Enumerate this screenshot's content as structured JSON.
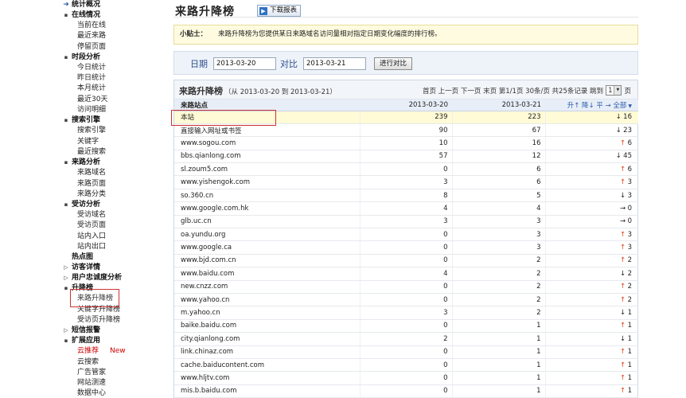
{
  "sidebar": {
    "groups": [
      {
        "label": "统计概况",
        "icon": "circle-arrow",
        "items": []
      },
      {
        "label": "在线情况",
        "icon": "minus",
        "items": [
          "当前在线",
          "最近来路",
          "停留页面"
        ]
      },
      {
        "label": "时段分析",
        "icon": "minus",
        "items": [
          "今日统计",
          "昨日统计",
          "本月统计",
          "最近30天",
          "访问明细"
        ]
      },
      {
        "label": "搜索引擎",
        "icon": "minus",
        "items": [
          "搜索引擎",
          "关键字",
          "最近搜索"
        ]
      },
      {
        "label": "来路分析",
        "icon": "minus",
        "items": [
          "来路域名",
          "来路页面",
          "来路分类"
        ]
      },
      {
        "label": "受访分析",
        "icon": "minus",
        "items": [
          "受访域名",
          "受访页面",
          "站内入口",
          "站内出口"
        ]
      },
      {
        "label": "热点图",
        "icon": "none",
        "items": []
      },
      {
        "label": "访客详情",
        "icon": "expand",
        "items": []
      },
      {
        "label": "用户忠诚度分析",
        "icon": "expand",
        "items": []
      },
      {
        "label": "升降榜",
        "icon": "minus",
        "items": [
          "来路升降榜",
          "关键字升降榜",
          "受访页升降榜"
        ]
      },
      {
        "label": "短信报警",
        "icon": "expand",
        "items": []
      },
      {
        "label": "扩展应用",
        "icon": "minus",
        "items": [
          "云推荐",
          "云搜索",
          "广告管家",
          "网站测速",
          "数据中心"
        ]
      }
    ],
    "new_badge": "New",
    "active_item": "来路升降榜"
  },
  "header": {
    "title": "来路升降榜",
    "download_label": "下载报表"
  },
  "tips": {
    "label": "小贴士：",
    "text": "来路升降榜为您提供某日来路域名访问量相对指定日期变化幅度的排行榜。"
  },
  "filter": {
    "date_label": "日期",
    "date_value": "2013-03-20",
    "compare_label": "对比",
    "compare_value": "2013-03-21",
    "button_label": "进行对比"
  },
  "panel": {
    "title": "来路升降榜",
    "range": "（从 2013-03-20 到 2013-03-21）",
    "pager_text": "首页 上一页 下一页 末页 第1/1页 30条/页 共25条记录 跳到",
    "page_select": "1",
    "page_suffix": "页"
  },
  "table": {
    "headers": [
      "来路站点",
      "2013-03-20",
      "2013-03-21",
      "升↑ 降↓ 平 → 全部"
    ],
    "rows": [
      {
        "site": "本站",
        "d1": "239",
        "d2": "223",
        "dir": "down",
        "chg": "16"
      },
      {
        "site": "直接输入网址或书签",
        "d1": "90",
        "d2": "67",
        "dir": "down",
        "chg": "23"
      },
      {
        "site": "www.sogou.com",
        "d1": "10",
        "d2": "16",
        "dir": "up",
        "chg": "6"
      },
      {
        "site": "bbs.qianlong.com",
        "d1": "57",
        "d2": "12",
        "dir": "down",
        "chg": "45"
      },
      {
        "site": "sl.zoum5.com",
        "d1": "0",
        "d2": "6",
        "dir": "up",
        "chg": "6"
      },
      {
        "site": "www.yishengok.com",
        "d1": "3",
        "d2": "6",
        "dir": "up",
        "chg": "3"
      },
      {
        "site": "so.360.cn",
        "d1": "8",
        "d2": "5",
        "dir": "down",
        "chg": "3"
      },
      {
        "site": "www.google.com.hk",
        "d1": "4",
        "d2": "4",
        "dir": "flat",
        "chg": "0"
      },
      {
        "site": "glb.uc.cn",
        "d1": "3",
        "d2": "3",
        "dir": "flat",
        "chg": "0"
      },
      {
        "site": "oa.yundu.org",
        "d1": "0",
        "d2": "3",
        "dir": "up",
        "chg": "3"
      },
      {
        "site": "www.google.ca",
        "d1": "0",
        "d2": "3",
        "dir": "up",
        "chg": "3"
      },
      {
        "site": "www.bjd.com.cn",
        "d1": "0",
        "d2": "2",
        "dir": "up",
        "chg": "2"
      },
      {
        "site": "www.baidu.com",
        "d1": "4",
        "d2": "2",
        "dir": "down",
        "chg": "2"
      },
      {
        "site": "new.cnzz.com",
        "d1": "0",
        "d2": "2",
        "dir": "up",
        "chg": "2"
      },
      {
        "site": "www.yahoo.cn",
        "d1": "0",
        "d2": "2",
        "dir": "up",
        "chg": "2"
      },
      {
        "site": "m.yahoo.cn",
        "d1": "3",
        "d2": "2",
        "dir": "down",
        "chg": "1"
      },
      {
        "site": "baike.baidu.com",
        "d1": "0",
        "d2": "1",
        "dir": "up",
        "chg": "1"
      },
      {
        "site": "city.qianlong.com",
        "d1": "2",
        "d2": "1",
        "dir": "down",
        "chg": "1"
      },
      {
        "site": "link.chinaz.com",
        "d1": "0",
        "d2": "1",
        "dir": "up",
        "chg": "1"
      },
      {
        "site": "cache.baiducontent.com",
        "d1": "0",
        "d2": "1",
        "dir": "up",
        "chg": "1"
      },
      {
        "site": "www.hljtv.com",
        "d1": "0",
        "d2": "1",
        "dir": "up",
        "chg": "1"
      },
      {
        "site": "mis.b.baidu.com",
        "d1": "0",
        "d2": "1",
        "dir": "up",
        "chg": "1"
      }
    ]
  },
  "colors": {
    "up": "#e0451a",
    "highlight_border": "#cc3333",
    "tips_bg": "#fffbe0",
    "filter_bg": "#eef3fa"
  }
}
